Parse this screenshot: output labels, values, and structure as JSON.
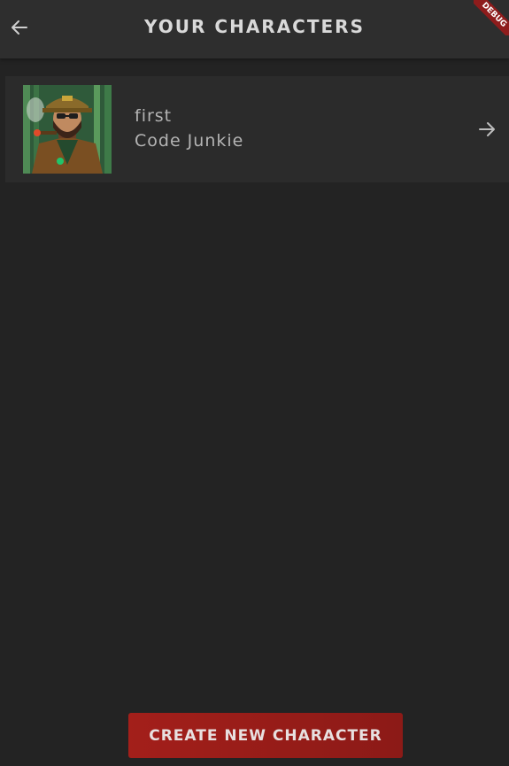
{
  "header": {
    "title": "YOUR CHARACTERS",
    "back_icon": "arrow-left-icon",
    "debug_banner": "DEBUG"
  },
  "characters": [
    {
      "name": "first",
      "class": "Code Junkie",
      "avatar": "pixel-art portrait of a bearded man in a green military cap and coat",
      "open_icon": "arrow-right-icon"
    }
  ],
  "actions": {
    "create_label": "CREATE NEW CHARACTER"
  },
  "colors": {
    "background": "#232323",
    "appbar": "#2e2e2e",
    "card": "#2b2b2b",
    "accent": "#a31f1a",
    "text": "#b4b4b4"
  }
}
